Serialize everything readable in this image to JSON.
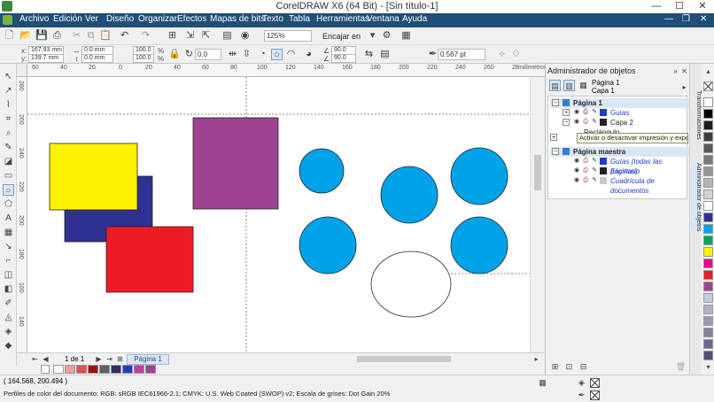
{
  "window": {
    "title": "CorelDRAW X6 (64 Bit) - [Sin título-1]",
    "controls": {
      "minimize": "—",
      "maximize": "☐",
      "close": "✕"
    }
  },
  "menu": {
    "items": [
      "Archivo",
      "Edición",
      "Ver",
      "Diseño",
      "Organizar",
      "Efectos",
      "Mapas de bits",
      "Texto",
      "Tabla",
      "Herramientas",
      "Ventana",
      "Ayuda"
    ],
    "doc_controls": {
      "minimize": "—",
      "restore": "❐",
      "close": "✕"
    }
  },
  "toolbar": {
    "zoom_value": "125%",
    "snap_label": "Encajar en",
    "undo_icon": "undo-icon",
    "redo_icon": "redo-icon"
  },
  "property_bar": {
    "x_label": "x:",
    "x_value": "167.93 mm",
    "y_label": "y:",
    "y_value": "139.7 mm",
    "w_value": "0.0 mm",
    "h_value": "0.0 mm",
    "scale_x": "100.0",
    "scale_y": "100.0",
    "percent": "%",
    "rotation": "0.0",
    "angle1": "90.0",
    "angle2": "90.0",
    "outline_width": "0.567 pt"
  },
  "rulers": {
    "top_ticks": [
      "60",
      "40",
      "20",
      "0",
      "20",
      "40",
      "60",
      "80",
      "100",
      "120",
      "140",
      "160",
      "180",
      "200",
      "220",
      "240",
      "260",
      "280"
    ],
    "top_unit": "milímetros",
    "left_ticks": [
      "280",
      "260",
      "240",
      "220",
      "200",
      "180",
      "160",
      "140"
    ]
  },
  "page_nav": {
    "page_count": "1 de 1",
    "page_tab": "Página 1"
  },
  "status": {
    "coordinates": "( 164.568, 200.494 )",
    "color_profile": "Perfiles de color del documento: RGB: sRGB IEC61966-2.1; CMYK: U.S. Web Coated (SWOP) v2; Escala de grises: Dot Gain 20%"
  },
  "docker": {
    "title": "Administrador de objetos",
    "page_header_1": "Página 1",
    "layer_header_1": "Capa 1",
    "tree": [
      {
        "label": "Página 1",
        "bold": true,
        "indent": 0
      },
      {
        "label": "Guías",
        "bold": false,
        "indent": 1,
        "color": "#1e3cc8"
      },
      {
        "label": "Capa 2",
        "bold": false,
        "indent": 1,
        "color": "#222222"
      },
      {
        "label": "Rectángulo",
        "bold": false,
        "indent": 2,
        "color": "#222222"
      },
      {
        "label": "Página maestra",
        "bold": true,
        "indent": 0
      },
      {
        "label": "Guías (todas las páginas)",
        "bold": false,
        "indent": 1,
        "color": "#1e3cc8",
        "italic": true
      },
      {
        "label": "Escritorio",
        "bold": false,
        "indent": 1,
        "color": "#222222",
        "italic": true
      },
      {
        "label": "Cuadrícula de documentos",
        "bold": false,
        "indent": 1,
        "color": "#808080",
        "italic": true
      }
    ],
    "tooltip": "Activar o desactivar impresión y exportación",
    "side_tabs": [
      "Transformaciones",
      "Administrador de objetos"
    ]
  },
  "canvas_shapes": {
    "yellow": "#fff200",
    "navy": "#2e3192",
    "red": "#ed1c24",
    "purple": "#9e4391",
    "cyan": "#00a2e8",
    "white": "#ffffff"
  },
  "palette": {
    "side": [
      "#ffffff",
      "#000000",
      "#1e1e1e",
      "#3b3b3b",
      "#595959",
      "#787878",
      "#969696",
      "#b4b4b4",
      "#d2d2d2",
      "#ffffff",
      "#2e3192",
      "#00a2e8",
      "#00a650",
      "#fff200",
      "#ec008c",
      "#ed1c24",
      "#9e4391",
      "#c8c8dc",
      "#b0b0c8",
      "#9898b4",
      "#8080a0",
      "#686890",
      "#50507c"
    ],
    "bottom": [
      "#ffffff",
      "#f0a0a0",
      "#e05050",
      "#a01010",
      "#606060",
      "#303060",
      "#1e3cc8",
      "#c83c9c",
      "#9e4391"
    ]
  }
}
